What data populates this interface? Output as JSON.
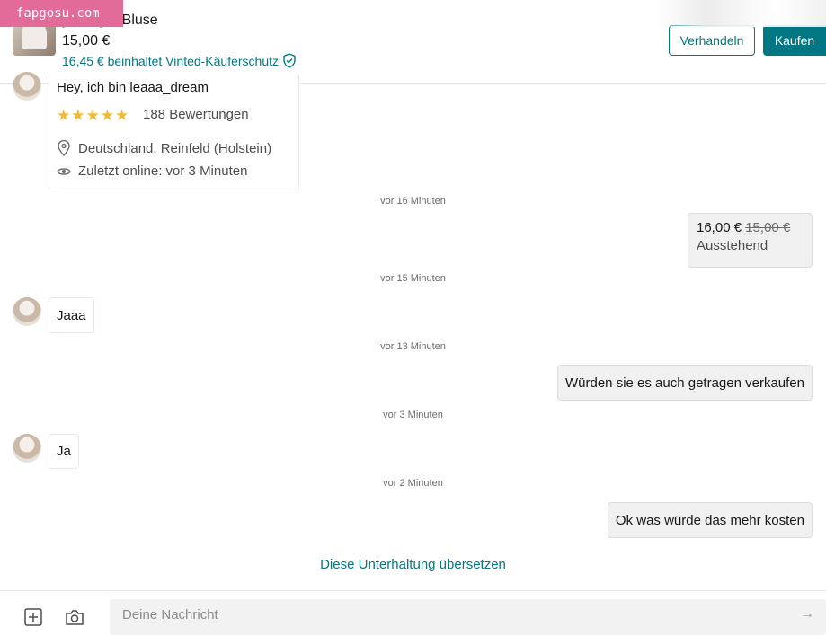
{
  "header": {
    "item_title": "y Hilfiger Bluse",
    "item_price": "15,00 €",
    "buyer_protection": "16,45 € beinhaltet Vinted-Käuferschutz",
    "negotiate_label": "Verhandeln",
    "buy_label": "Kaufen"
  },
  "watermark": "fapgosu.com",
  "seller_card": {
    "greeting": "Hey, ich bin leaaa_dream",
    "rating_stars": 5,
    "reviews": "188 Bewertungen",
    "location": "Deutschland, Reinfeld (Holstein)",
    "last_online": "Zuletzt online: vor 3 Minuten"
  },
  "messages": [
    {
      "timestamp": "vor 16 Minuten"
    },
    {
      "offer": {
        "new_price": "16,00 €",
        "old_price": "15,00 €",
        "status": "Ausstehend"
      }
    },
    {
      "timestamp": "vor 15 Minuten"
    },
    {
      "in": "Jaaa"
    },
    {
      "timestamp": "vor 13 Minuten"
    },
    {
      "out": "Würden sie es auch getragen verkaufen"
    },
    {
      "timestamp": "vor 3 Minuten"
    },
    {
      "in": "Ja"
    },
    {
      "timestamp": "vor 2 Minuten"
    },
    {
      "out": "Ok was würde das mehr kosten"
    }
  ],
  "translate_link": "Diese Unterhaltung übersetzen",
  "composer": {
    "placeholder": "Deine Nachricht",
    "value": ""
  },
  "icons": [
    "plus-square-icon",
    "camera-icon",
    "send-arrow-icon",
    "shield-check-icon",
    "location-pin-icon",
    "eye-icon",
    "star-icon"
  ],
  "colors": {
    "accent": "#007782",
    "star": "#f2b934",
    "watermark_bg": "#e36b9a"
  }
}
